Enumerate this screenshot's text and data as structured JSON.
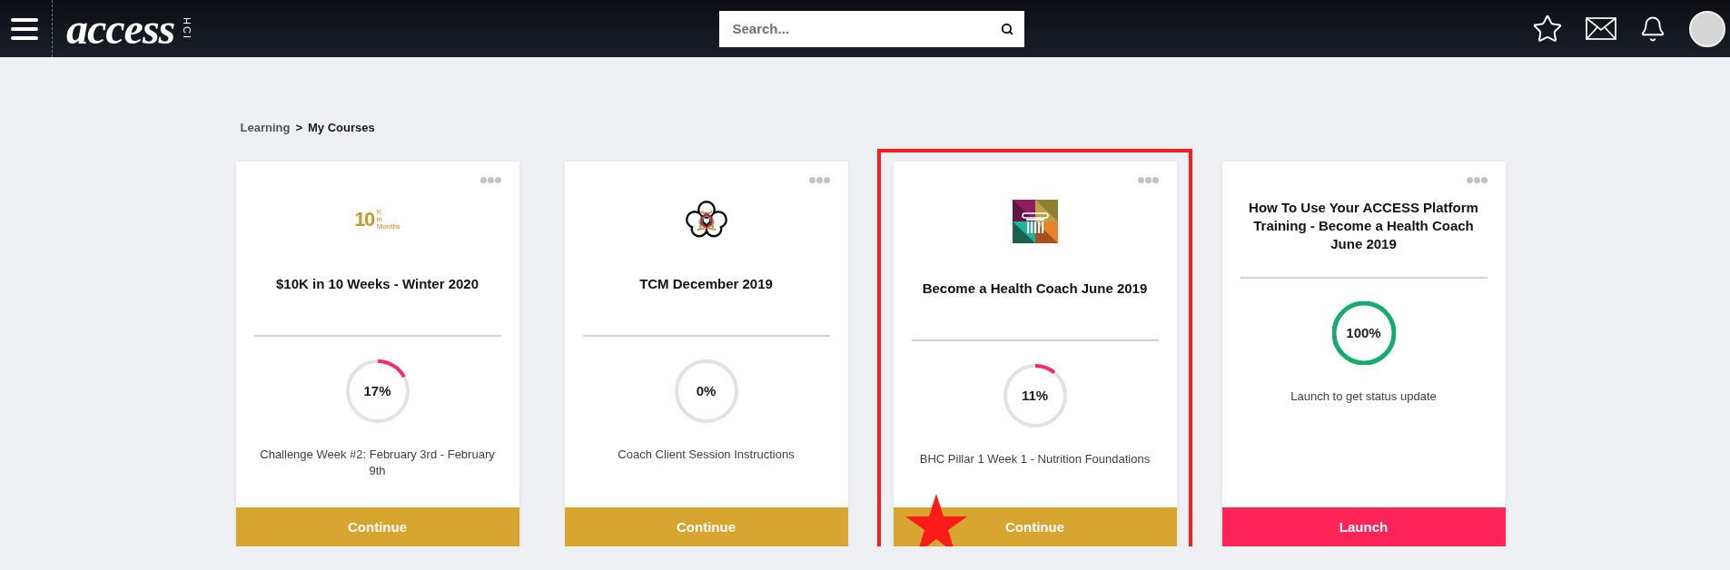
{
  "header": {
    "logo": {
      "word": "access",
      "tag": "HCI"
    },
    "search": {
      "placeholder": "Search..."
    }
  },
  "breadcrumb": {
    "items": [
      {
        "label": "Learning",
        "current": false
      },
      {
        "label": "My Courses",
        "current": true
      }
    ],
    "separator": ">"
  },
  "cards": [
    {
      "image": {
        "kind": "wordmark",
        "big": "10",
        "small": [
          "K",
          "in",
          "Months"
        ]
      },
      "title": "$10K in 10 Weeks - Winter 2020",
      "level": 0.17,
      "percent": "17%",
      "subtitle": "Challenge Week #2: February 3rd - February 9th",
      "button": {
        "kind": "continue",
        "label": "Continue"
      },
      "highlighted": false
    },
    {
      "image": {
        "kind": "cloud-emblem"
      },
      "title": "TCM December 2019",
      "level": 0,
      "percent": "0%",
      "subtitle": "Coach Client Session Instructions",
      "button": {
        "kind": "continue",
        "label": "Continue"
      },
      "highlighted": false
    },
    {
      "image": {
        "kind": "column-tile"
      },
      "title": "Become a Health Coach June 2019",
      "level": 0.11,
      "percent": "11%",
      "subtitle": "BHC Pillar 1 Week 1 - Nutrition Foundations",
      "button": {
        "kind": "continue",
        "label": "Continue"
      },
      "highlighted": true
    },
    {
      "title": "How To Use Your ACCESS Platform Training - Become a Health Coach June 2019",
      "level": 1,
      "percent": "100%",
      "subtitle": "Launch to get status update",
      "button": {
        "kind": "launch",
        "label": "Launch"
      },
      "highlighted": false
    }
  ]
}
